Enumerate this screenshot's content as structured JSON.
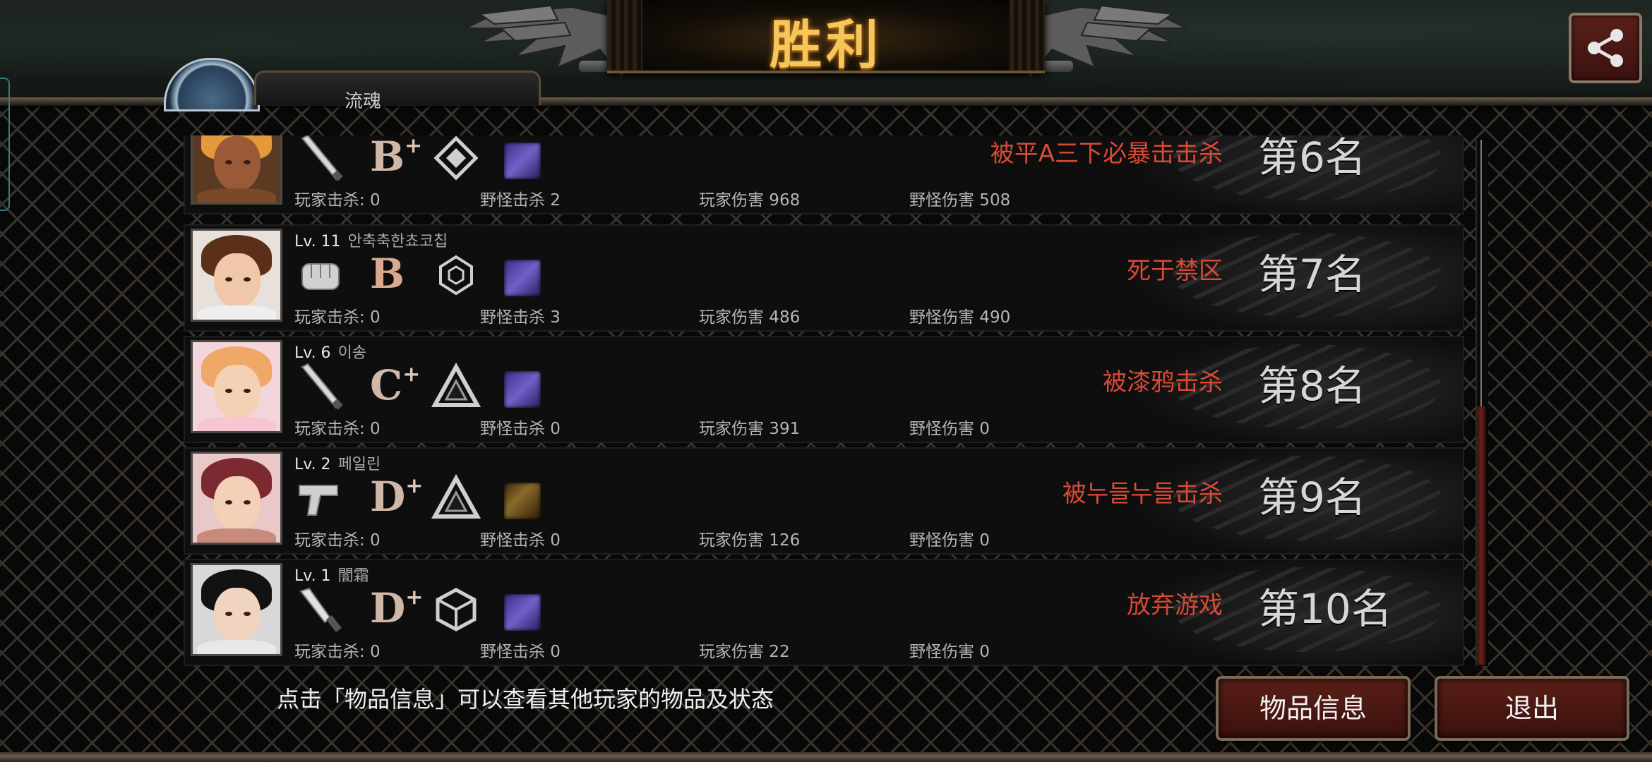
{
  "header": {
    "title": "胜利",
    "left_panel_text": "流魂"
  },
  "players": [
    {
      "level": "",
      "name": "",
      "weapon_icon": "bat-icon",
      "grade": "B",
      "grade_plus": "+",
      "mastery_icon": "diamond-emblem-icon",
      "trait": "purple-crystal-icon",
      "status": "被平A三下必暴击击杀",
      "rank": "第6名",
      "stats": {
        "player_kills": "玩家击杀: 0",
        "monster_kills": "野怪击杀 2",
        "player_damage": "玩家伤害 968",
        "monster_damage": "野怪伤害 508"
      },
      "avatar": {
        "hair": "#e49a3a",
        "skin": "#9a5a38",
        "body": "#7a4a28"
      }
    },
    {
      "level": "Lv. 11",
      "name": "안축축한쵸코칩",
      "weapon_icon": "fist-icon",
      "grade": "B",
      "grade_plus": "",
      "mastery_icon": "hexagon-emblem-icon",
      "trait": "purple-crystal-icon",
      "status": "死于禁区",
      "rank": "第7名",
      "stats": {
        "player_kills": "玩家击杀: 0",
        "monster_kills": "野怪击杀 3",
        "player_damage": "玩家伤害 486",
        "monster_damage": "野怪伤害 490"
      },
      "avatar": {
        "hair": "#5a3018",
        "skin": "#f0c7a8",
        "body": "#efefef"
      }
    },
    {
      "level": "Lv. 6",
      "name": "이송",
      "weapon_icon": "bat-icon",
      "grade": "C",
      "grade_plus": "+",
      "mastery_icon": "triangle-emblem-icon",
      "trait": "purple-crystal-icon",
      "status": "被漆鸦击杀",
      "rank": "第8名",
      "stats": {
        "player_kills": "玩家击杀: 0",
        "monster_kills": "野怪击杀 0",
        "player_damage": "玩家伤害 391",
        "monster_damage": "野怪伤害 0"
      },
      "avatar": {
        "hair": "#f0a868",
        "skin": "#f4d0b4",
        "body": "#f7c6d2"
      }
    },
    {
      "level": "Lv. 2",
      "name": "페일린",
      "weapon_icon": "pistol-icon",
      "grade": "D",
      "grade_plus": "+",
      "mastery_icon": "triangle-emblem-icon",
      "trait": "gold-claws-icon",
      "status": "被누들누들击杀",
      "rank": "第9名",
      "stats": {
        "player_kills": "玩家击杀: 0",
        "monster_kills": "野怪击杀 0",
        "player_damage": "玩家伤害 126",
        "monster_damage": "野怪伤害 0"
      },
      "avatar": {
        "hair": "#7a2a30",
        "skin": "#f4d0b8",
        "body": "#c88a7a"
      }
    },
    {
      "level": "Lv. 1",
      "name": "闇霜",
      "weapon_icon": "knife-icon",
      "grade": "D",
      "grade_plus": "+",
      "mastery_icon": "cube-emblem-icon",
      "trait": "purple-crystal-icon",
      "status": "放弃游戏",
      "rank": "第10名",
      "stats": {
        "player_kills": "玩家击杀: 0",
        "monster_kills": "野怪击杀 0",
        "player_damage": "玩家伤害 22",
        "monster_damage": "野怪伤害 0"
      },
      "avatar": {
        "hair": "#121212",
        "skin": "#f0d4c0",
        "body": "#e8e8e8"
      }
    }
  ],
  "footer": {
    "hint": "点击「物品信息」可以查看其他玩家的物品及状态",
    "items_button": "物品信息",
    "exit_button": "退出"
  },
  "colors": {
    "status_red": "#d84a36",
    "title_gold": "#f6c65a",
    "button_red": "#5b1f18"
  }
}
